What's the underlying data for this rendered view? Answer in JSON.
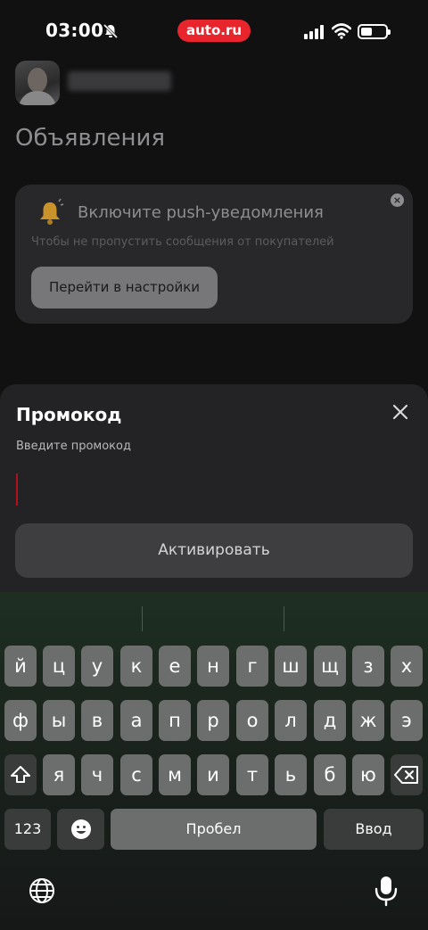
{
  "status_bar": {
    "time": "03:00",
    "app_badge": "auto.ru",
    "icons": [
      "bell-slash-icon",
      "cellular-signal-icon",
      "wifi-icon",
      "battery-icon"
    ]
  },
  "background": {
    "page_title": "Объявления",
    "push_card": {
      "title": "Включите push-уведомления",
      "subtitle": "Чтобы не пропустить сообщения от покупателей",
      "button_label": "Перейти в настройки"
    }
  },
  "sheet": {
    "title": "Промокод",
    "field_label": "Введите промокод",
    "field_value": "",
    "activate_label": "Активировать"
  },
  "keyboard": {
    "row1": [
      "й",
      "ц",
      "у",
      "к",
      "е",
      "н",
      "г",
      "ш",
      "щ",
      "з",
      "х"
    ],
    "row2": [
      "ф",
      "ы",
      "в",
      "а",
      "п",
      "р",
      "о",
      "л",
      "д",
      "ж",
      "э"
    ],
    "row3": [
      "я",
      "ч",
      "с",
      "м",
      "и",
      "т",
      "ь",
      "б",
      "ю"
    ],
    "numbers_label": "123",
    "space_label": "Пробел",
    "enter_label": "Ввод"
  },
  "colors": {
    "brand": "#e8242c",
    "background": "#111112",
    "sheet": "#232325",
    "caret": "#b4121b"
  }
}
